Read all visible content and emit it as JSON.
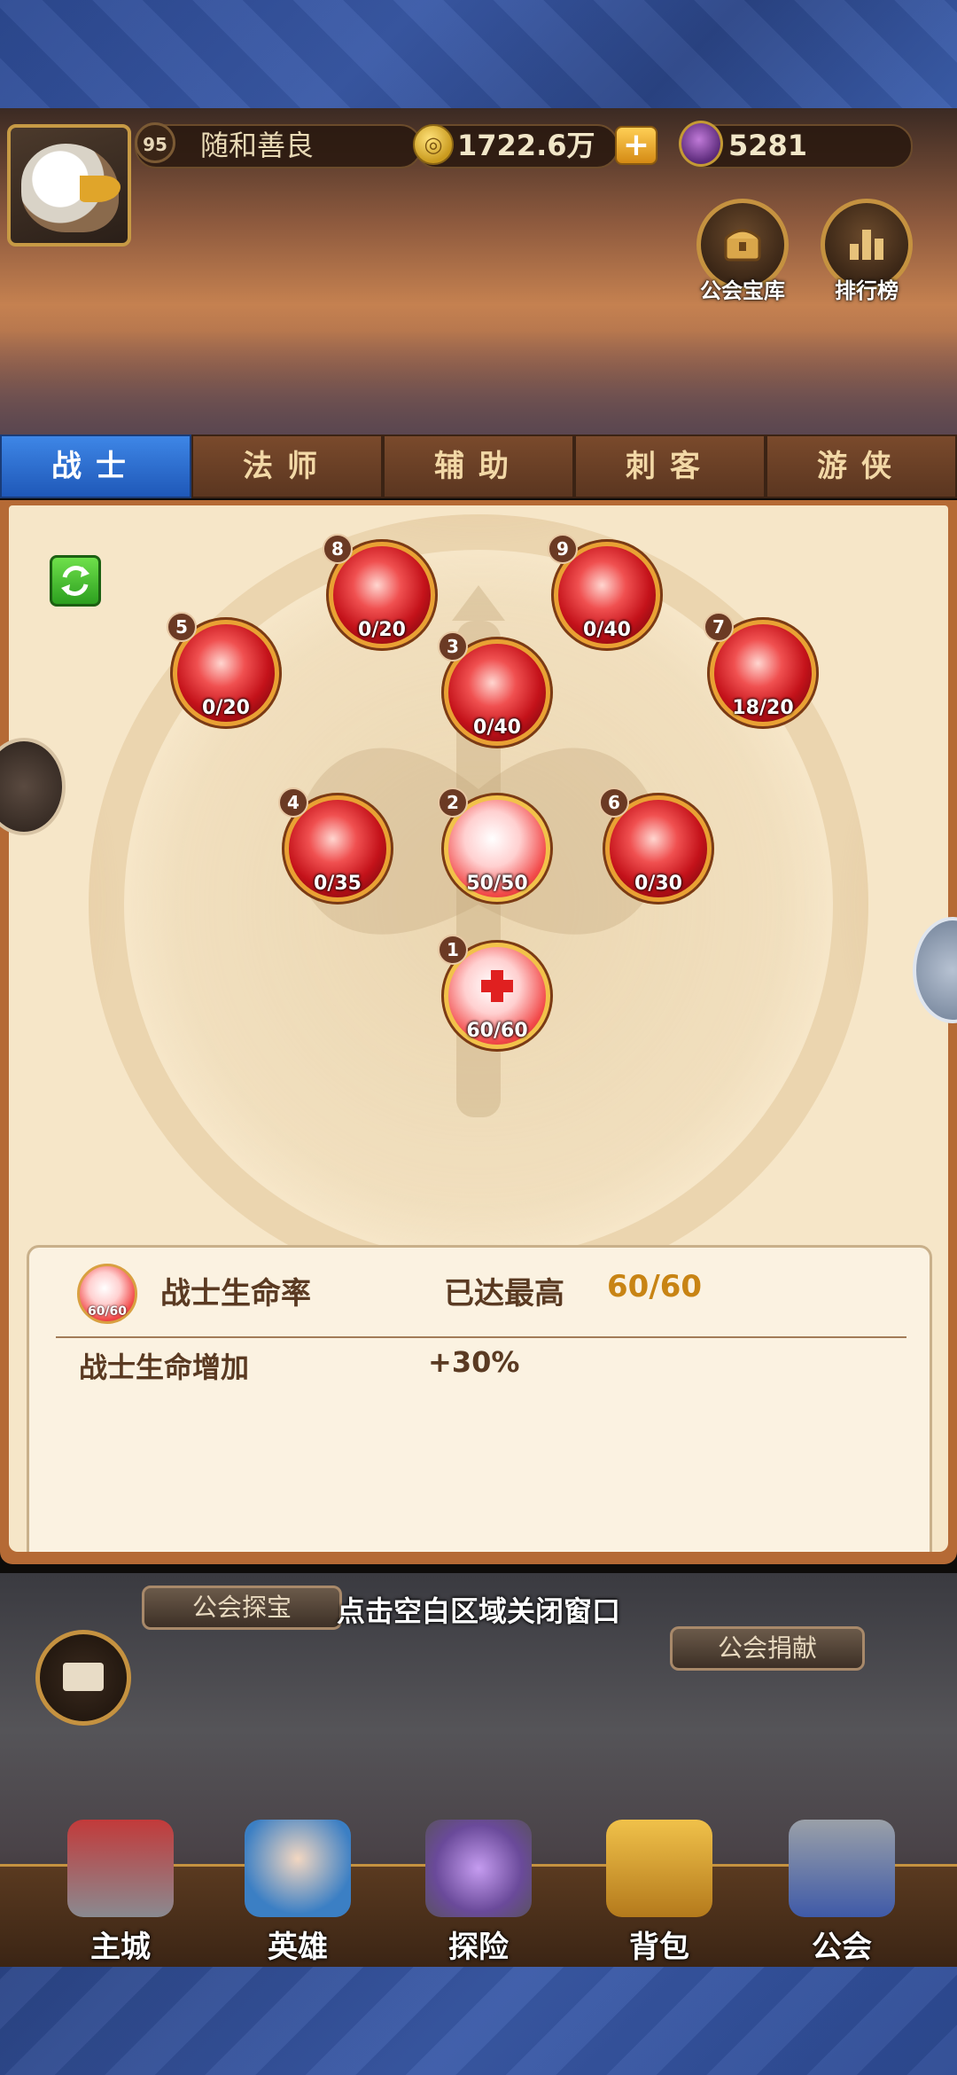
{
  "header": {
    "level": "95",
    "player_name": "随和善良",
    "gold": "1722.6万",
    "gold_plus": "+",
    "gems": "5281",
    "guild_vault_label": "公会宝库",
    "ranking_label": "排行榜"
  },
  "tabs": [
    {
      "label": "战士",
      "active": true
    },
    {
      "label": "法师",
      "active": false
    },
    {
      "label": "辅助",
      "active": false
    },
    {
      "label": "刺客",
      "active": false
    },
    {
      "label": "游侠",
      "active": false
    }
  ],
  "talent_nodes": [
    {
      "num": "1",
      "progress": "60/60"
    },
    {
      "num": "2",
      "progress": "50/50"
    },
    {
      "num": "3",
      "progress": "0/40"
    },
    {
      "num": "4",
      "progress": "0/35"
    },
    {
      "num": "5",
      "progress": "0/20"
    },
    {
      "num": "6",
      "progress": "0/30"
    },
    {
      "num": "7",
      "progress": "18/20"
    },
    {
      "num": "8",
      "progress": "0/20"
    },
    {
      "num": "9",
      "progress": "0/40"
    }
  ],
  "detail": {
    "icon_progress": "60/60",
    "name": "战士生命率",
    "status": "已达最高",
    "progress": "60/60",
    "effect_label": "战士生命增加",
    "effect_value": "+30%"
  },
  "scene": {
    "treasure_label": "公会探宝",
    "close_hint": "点击空白区域关闭窗口",
    "donate_label": "公会捐献"
  },
  "bottom_nav": [
    {
      "label": "主城"
    },
    {
      "label": "英雄"
    },
    {
      "label": "探险"
    },
    {
      "label": "背包"
    },
    {
      "label": "公会"
    }
  ],
  "colors": {
    "active_tab": "#2f6fd1",
    "progress_gold": "#c88414",
    "frame_blue": "#3a5aa8"
  },
  "icons": [
    "eagle-avatar-icon",
    "gold-coin-icon",
    "gem-icon",
    "treasure-chest-icon",
    "ranking-bars-icon",
    "refresh-icon",
    "mail-icon",
    "warrior-axe-emblem"
  ]
}
